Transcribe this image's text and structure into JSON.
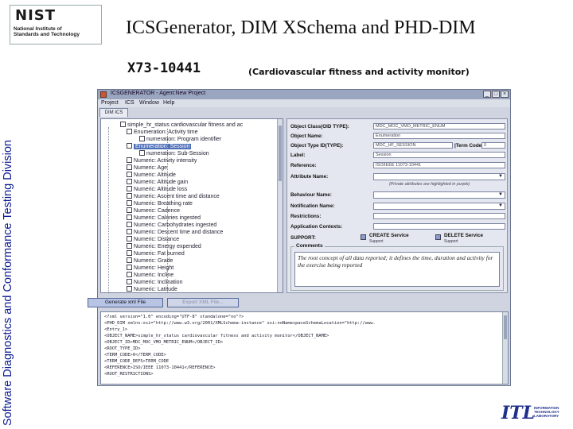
{
  "slide": {
    "logo_word": "NIST",
    "logo_sub_1": "National Institute of",
    "logo_sub_2": "Standards and Technology",
    "side_text": "Software Diagnostics and Conformance Testing Division",
    "title": "ICSGenerator, DIM XSchema and PHD-DIM",
    "code": "X73-10441",
    "subtitle": "(Cardiovascular fitness and activity monitor)",
    "itl_mark": "ITL",
    "itl_text_1": "INFORMATION",
    "itl_text_2": "TECHNOLOGY",
    "itl_text_3": "LABORATORY"
  },
  "window": {
    "title": "ICSGENERATOR - Agent:New Project",
    "menus": [
      "Project",
      "ICS",
      "Window",
      "Help"
    ],
    "tab": "DIM ICS"
  },
  "tree": {
    "items": [
      {
        "label": "simple_hr_status cardiovascular fitness and ac",
        "sel": false
      },
      {
        "label": "Enumeration: Activity time",
        "sel": false
      },
      {
        "label": "numeration: Program identifier",
        "sel": false
      },
      {
        "label": "Enumeration: Session",
        "sel": true
      },
      {
        "label": "numeration: Sub-Session",
        "sel": false
      },
      {
        "label": "Numeric: Activity intensity",
        "sel": false
      },
      {
        "label": "Numeric: Age",
        "sel": false
      },
      {
        "label": "Numeric: Altitude",
        "sel": false
      },
      {
        "label": "Numeric: Altitude gain",
        "sel": false
      },
      {
        "label": "Numeric: Altitude loss",
        "sel": false
      },
      {
        "label": "Numeric: Ascent time and distance",
        "sel": false
      },
      {
        "label": "Numeric: Breathing rate",
        "sel": false
      },
      {
        "label": "Numeric: Cadence",
        "sel": false
      },
      {
        "label": "Numeric: Calories ingested",
        "sel": false
      },
      {
        "label": "Numeric: Carbohydrates ingested",
        "sel": false
      },
      {
        "label": "Numeric: Descent time and distance",
        "sel": false
      },
      {
        "label": "Numeric: Distance",
        "sel": false
      },
      {
        "label": "Numeric: Energy expended",
        "sel": false
      },
      {
        "label": "Numeric: Fat burned",
        "sel": false
      },
      {
        "label": "Numeric: Grade",
        "sel": false
      },
      {
        "label": "Numeric: Height",
        "sel": false
      },
      {
        "label": "Numeric: Incline",
        "sel": false
      },
      {
        "label": "Numeric: Inclination",
        "sel": false
      },
      {
        "label": "Numeric: Latitude",
        "sel": false
      }
    ]
  },
  "form": {
    "object_class_label": "Object Class(OID TYPE):",
    "object_class_value": "MDC_MOC_VMO_METRIC_ENUM",
    "object_name_label": "Object Name:",
    "object_name_value": "Enumeration",
    "object_type_label": "Object Type ID(TYPE):",
    "object_type_value": "MDC_HF_SESSION",
    "term_code_label": "|Term Code:",
    "term_code_value": "0",
    "label_label": "Label:",
    "label_value": "Session",
    "reference_label": "Reference:",
    "reference_value": "ISO/IEEE 11073-10441",
    "attribute_label": "Attribute Name:",
    "attribute_hint": "(Private attributes are highlighted in purple)",
    "behaviour_label": "Behaviour Name:",
    "notification_label": "Notification Name:",
    "restrictions_label": "Restrictions:",
    "application_label": "Application Contexts:",
    "support_label": "SUPPORT:",
    "create_label": "CREATE Service",
    "create_sub": "Support",
    "delete_label": "DELETE Service",
    "delete_sub": "Support",
    "comments_label": "Comments",
    "comments_text": "The root concept of all data reported; it defines the time, duration and activity for the exercise being reported"
  },
  "buttons": {
    "generate": "Generate xml File",
    "export": "Export XML File..."
  },
  "xml": {
    "lines": [
      "<?xml version=\"1.0\" encoding=\"UTF-8\" standalone=\"no\"?>",
      "<PHD_DIM xmlns:xsi=\"http://www.w3.org/2001/XMLSchema-instance\" xsi:noNamespaceSchemaLocation=\"http://www.",
      "  <Entry_1>",
      "    <OBJECT_NAME>simple_hr_status cardiovascular fitness and activity monitor</OBJECT_NAME>",
      "    <OBJECT_ID>MDC_MOC_VMO_METRIC_ENUM</OBJECT_ID>",
      "    <ROOT_TYPE_ID>",
      "    <TERM_CODE>0</TERM_CODE>",
      "    <TERM_CODE_DEFS>TERM_CODE",
      "    <REFERENCE>ISO/IEEE 11073-10441</REFERENCE>",
      "    <ROOT_RESTRICTIONS>"
    ]
  }
}
